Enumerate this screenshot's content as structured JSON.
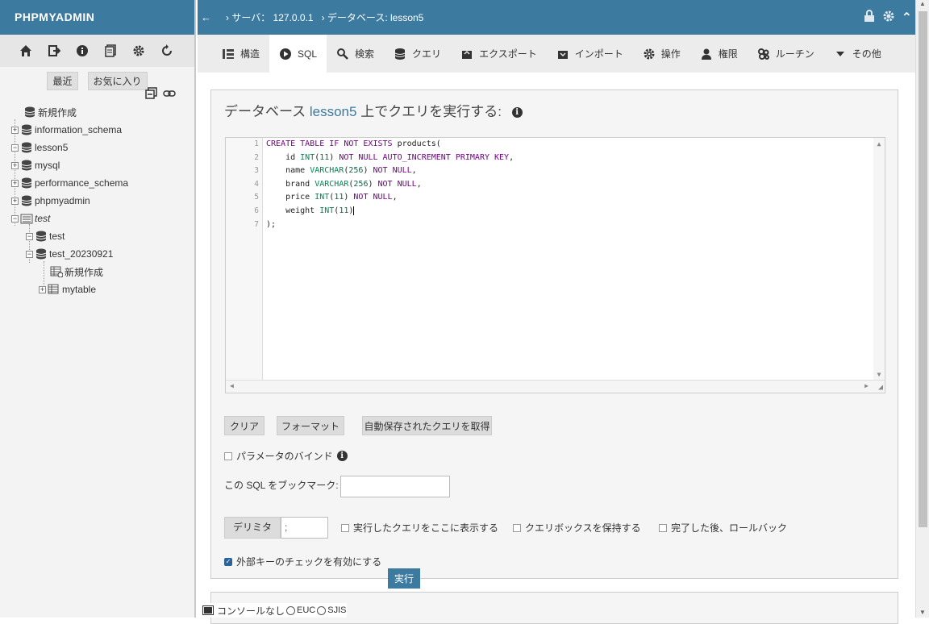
{
  "app": {
    "logo": "PHPMYADMIN"
  },
  "sidebar": {
    "recent": "最近",
    "favorites": "お気に入り",
    "tree": [
      {
        "label": "新規作成",
        "level": 0
      },
      {
        "label": "information_schema",
        "level": 0
      },
      {
        "label": "lesson5",
        "level": 0
      },
      {
        "label": "mysql",
        "level": 0
      },
      {
        "label": "performance_schema",
        "level": 0
      },
      {
        "label": "phpmyadmin",
        "level": 0
      },
      {
        "label": "test",
        "level": 0
      },
      {
        "label": "test",
        "level": 1
      },
      {
        "label": "test_20230921",
        "level": 1
      },
      {
        "label": "新規作成",
        "level": 2
      },
      {
        "label": "mytable",
        "level": 2
      }
    ]
  },
  "breadcrumb": {
    "server": "› サーバ： 127.0.0.1",
    "database": "› データベース: lesson5"
  },
  "tabs": [
    {
      "label": "構造",
      "icon": "structure-icon"
    },
    {
      "label": "SQL",
      "icon": "play-icon"
    },
    {
      "label": "検索",
      "icon": "search-icon"
    },
    {
      "label": "クエリ",
      "icon": "database-icon"
    },
    {
      "label": "エクスポート",
      "icon": "export-icon"
    },
    {
      "label": "インポート",
      "icon": "import-icon"
    },
    {
      "label": "操作",
      "icon": "gear-icon"
    },
    {
      "label": "権限",
      "icon": "user-icon"
    },
    {
      "label": "ルーチン",
      "icon": "routines-icon"
    },
    {
      "label": "その他",
      "icon": "caret-down-icon"
    }
  ],
  "query": {
    "heading_pre": "データベース ",
    "heading_db": "lesson5",
    "heading_post": " 上でクエリを実行する:",
    "line_numbers": [
      "1",
      "2",
      "3",
      "4",
      "5",
      "6",
      "7"
    ]
  },
  "buttons": {
    "clear": "クリア",
    "format": "フォーマット",
    "autosave": "自動保存されたクエリを取得",
    "go": "実行"
  },
  "options": {
    "bind_params": "パラメータのバインド",
    "bookmark_label": "この SQL をブックマーク:",
    "delimiter_label": "デリミタ",
    "delimiter_value": ";",
    "show_query": "実行したクエリをここに表示する",
    "retain_box": "クエリボックスを保持する",
    "rollback": "完了した後、ロールバック",
    "foreign_key": "外部キーのチェックを有効にする"
  },
  "console": {
    "label": "コンソール",
    "none": "なし",
    "euc": "EUC",
    "sjis": "SJIS"
  }
}
